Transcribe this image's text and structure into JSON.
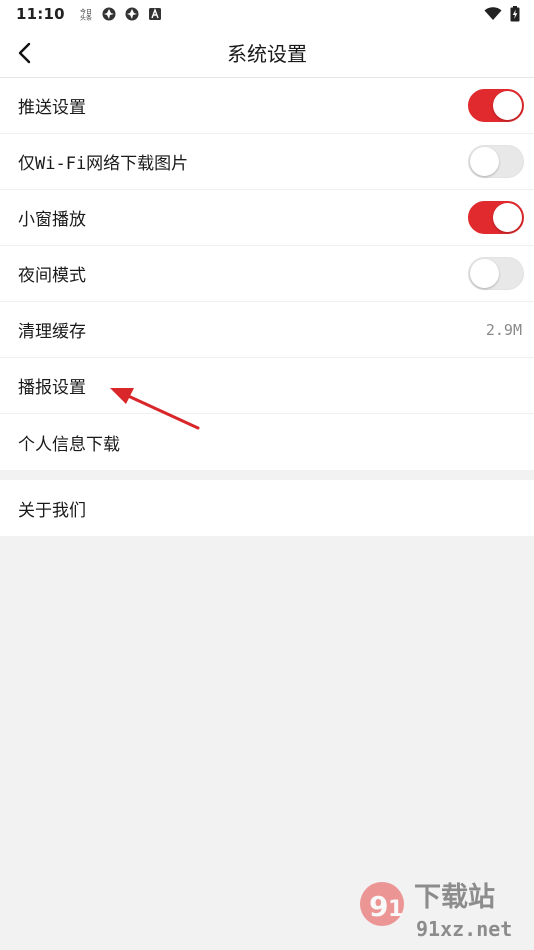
{
  "status_bar": {
    "time": "11:10",
    "left_icons": [
      "notification-glyph-icon",
      "app-shutter-icon",
      "app-shutter-icon",
      "a-box-icon"
    ],
    "right_icons": [
      "wifi-icon",
      "battery-charging-icon"
    ]
  },
  "header": {
    "title": "系统设置",
    "back_icon": "chevron-left-icon"
  },
  "settings_group_1": [
    {
      "label": "推送设置",
      "control": "toggle",
      "on": true
    },
    {
      "label": "仅Wi-Fi网络下载图片",
      "control": "toggle",
      "on": false
    },
    {
      "label": "小窗播放",
      "control": "toggle",
      "on": true
    },
    {
      "label": "夜间模式",
      "control": "toggle",
      "on": false
    },
    {
      "label": "清理缓存",
      "control": "value",
      "value": "2.9M"
    },
    {
      "label": "播报设置",
      "control": "none"
    },
    {
      "label": "个人信息下载",
      "control": "none"
    }
  ],
  "settings_group_2": [
    {
      "label": "关于我们",
      "control": "none"
    }
  ],
  "annotation": {
    "type": "red-arrow",
    "points_to": "播报设置"
  },
  "watermark": {
    "brand_text": "下载站",
    "url_text": "91xz.net"
  },
  "colors": {
    "toggle_on": "#e02a2d",
    "toggle_off": "#e8e8e8",
    "background": "#f2f2f2",
    "arrow": "#d9262b"
  }
}
